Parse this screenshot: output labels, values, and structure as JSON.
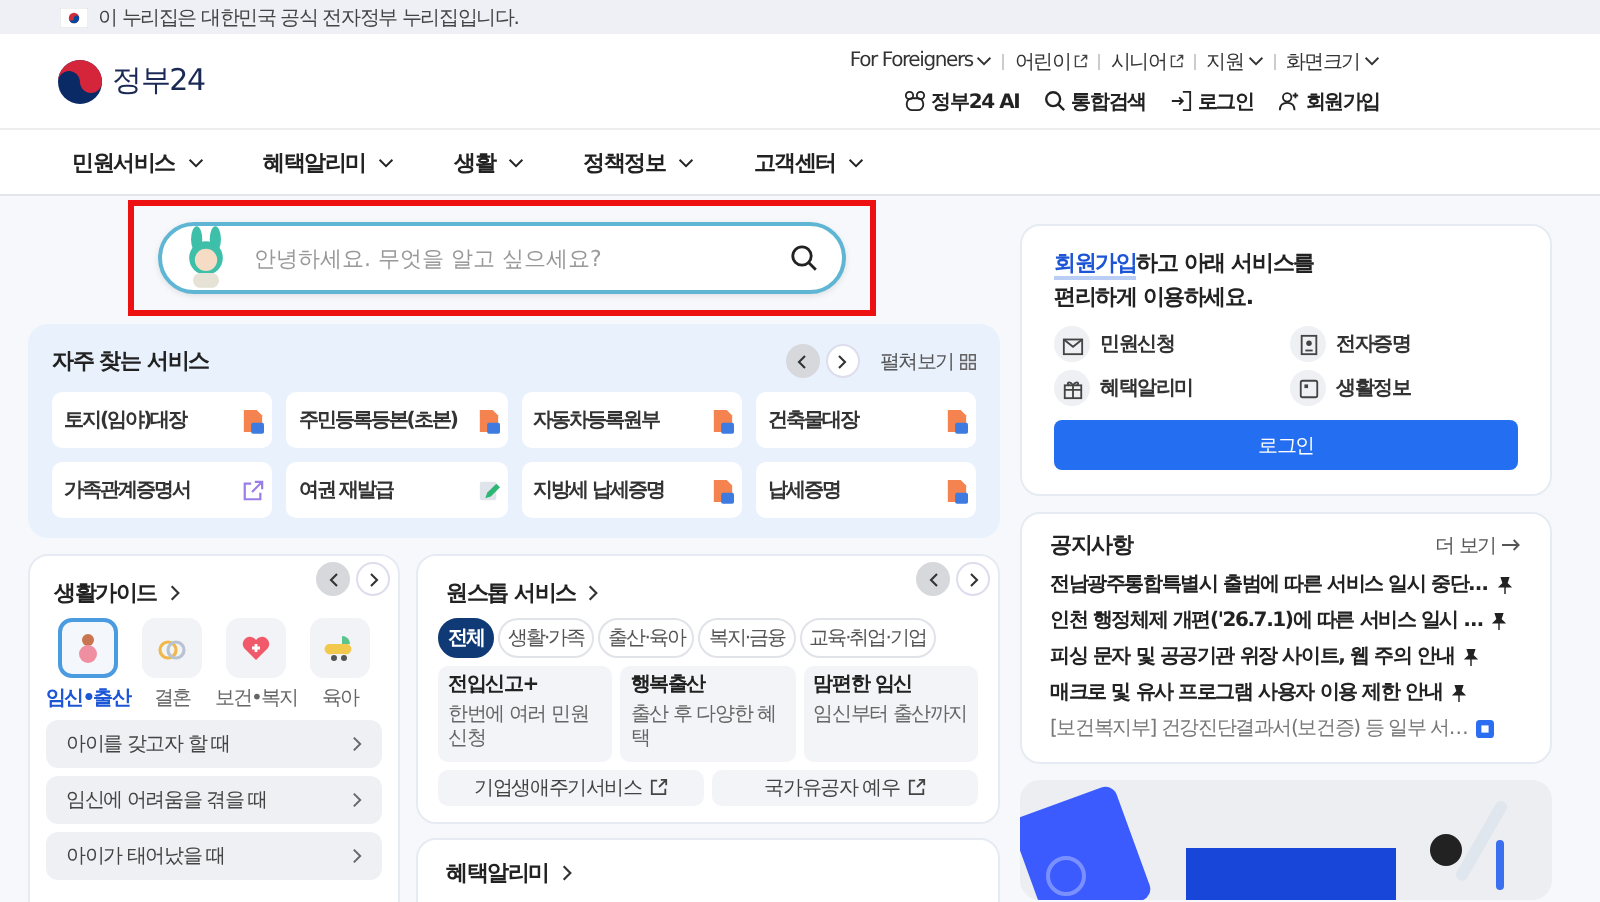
{
  "gov_banner": {
    "text": "이 누리집은 대한민국 공식 전자정부 누리집입니다."
  },
  "header": {
    "logo_text": "정부24",
    "util_links": [
      {
        "label": "For Foreigners",
        "kind": "menu"
      },
      {
        "label": "어린이",
        "kind": "external"
      },
      {
        "label": "시니어",
        "kind": "external"
      },
      {
        "label": "지원",
        "kind": "menu"
      },
      {
        "label": "화면크기",
        "kind": "menu"
      }
    ],
    "actions": [
      {
        "label": "정부24 AI",
        "kind": "ai"
      },
      {
        "label": "통합검색",
        "kind": "search"
      },
      {
        "label": "로그인",
        "kind": "login"
      },
      {
        "label": "회원가입",
        "kind": "signup"
      }
    ]
  },
  "nav": [
    "민원서비스",
    "혜택알리미",
    "생활",
    "정책정보",
    "고객센터"
  ],
  "search": {
    "placeholder": "안녕하세요. 무엇을 알고 싶으세요?",
    "highlighted": true
  },
  "frequent": {
    "title": "자주 찾는 서비스",
    "expand_label": "펼쳐보기",
    "pager": [
      {
        "kind": "prev",
        "disabled": true
      },
      {
        "kind": "next",
        "disabled": false
      }
    ],
    "items": [
      {
        "label": "토지(임야)대장",
        "kind": "doc"
      },
      {
        "label": "주민등록등본(초본)",
        "kind": "doc"
      },
      {
        "label": "자동차등록원부",
        "kind": "doc"
      },
      {
        "label": "건축물대장",
        "kind": "doc"
      },
      {
        "label": "가족관계증명서",
        "kind": "link"
      },
      {
        "label": "여권 재발급",
        "kind": "edit"
      },
      {
        "label": "지방세 납세증명",
        "kind": "doc"
      },
      {
        "label": "납세증명",
        "kind": "doc"
      }
    ]
  },
  "login_card": {
    "link": "회원가입",
    "message_line1": "하고 아래 서비스를",
    "message_line2": "편리하게 이용하세요.",
    "services": [
      {
        "label": "민원신청",
        "kind": "mail"
      },
      {
        "label": "전자증명",
        "kind": "cert"
      },
      {
        "label": "혜택알리미",
        "kind": "gift"
      },
      {
        "label": "생활정보",
        "kind": "note"
      }
    ],
    "button": "로그인"
  },
  "life_guide": {
    "title": "생활가이드",
    "pager": [
      {
        "kind": "prev",
        "disabled": true
      },
      {
        "kind": "next",
        "disabled": false
      }
    ],
    "categories": [
      {
        "label": "임신•출산",
        "kind": "pregnancy",
        "selected": true
      },
      {
        "label": "결혼",
        "kind": "wedding",
        "selected": false
      },
      {
        "label": "보건•복지",
        "kind": "health",
        "selected": false
      },
      {
        "label": "육아",
        "kind": "childcare",
        "selected": false
      }
    ],
    "items": [
      "아이를 갖고자 할 때",
      "임신에 어려움을 겪을 때",
      "아이가 태어났을 때"
    ]
  },
  "onestop": {
    "title": "원스톱 서비스",
    "pager": [
      {
        "kind": "prev",
        "disabled": true
      },
      {
        "kind": "next",
        "disabled": false
      }
    ],
    "tabs": [
      {
        "label": "전체",
        "selected": true
      },
      {
        "label": "생활·가족",
        "selected": false
      },
      {
        "label": "출산·육아",
        "selected": false
      },
      {
        "label": "복지·금융",
        "selected": false
      },
      {
        "label": "교육·취업·기업",
        "selected": false
      }
    ],
    "cards": [
      {
        "title": "전입신고+",
        "subtitle": "한번에 여러 민원 신청"
      },
      {
        "title": "행복출산",
        "subtitle": "출산 후 다양한 혜택"
      },
      {
        "title": "맘편한 임신",
        "subtitle": "임신부터 출산까지"
      }
    ],
    "links": [
      "기업생애주기서비스",
      "국가유공자 예우"
    ]
  },
  "benefits": {
    "title": "혜택알리미"
  },
  "notices": {
    "title": "공지사항",
    "more": "더 보기",
    "items": [
      {
        "text": "전남광주통합특별시 출범에 따른 서비스 일시 중단…",
        "kind": "pin"
      },
      {
        "text": "인천 행정체제 개편('26.7.1)에 따른 서비스 일시 …",
        "kind": "pin"
      },
      {
        "text": "피싱 문자 및 공공기관 위장 사이트, 웹 주의 안내",
        "kind": "pin"
      },
      {
        "text": "매크로 및 유사 프로그램 사용자 이용 제한 안내",
        "kind": "pin"
      },
      {
        "text": "[보건복지부] 건강진단결과서(보건증) 등 일부 서…",
        "kind": "new"
      }
    ]
  }
}
